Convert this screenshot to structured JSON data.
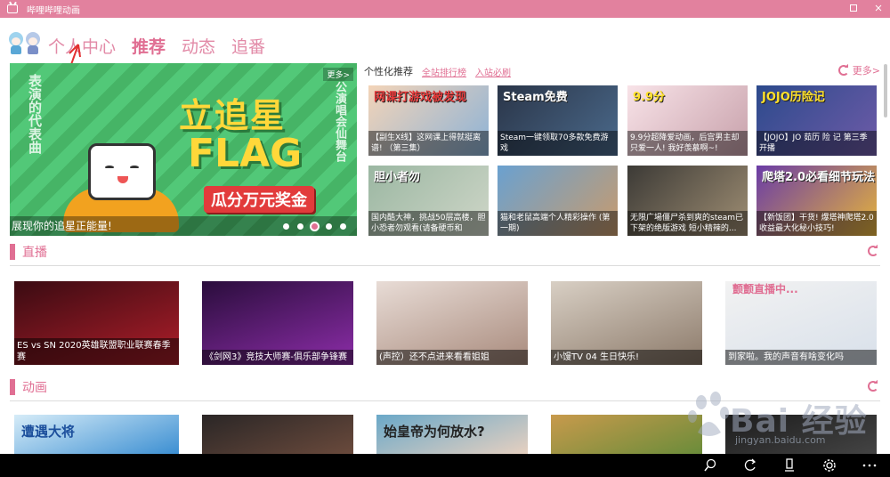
{
  "window": {
    "title": "哔哩哔哩动画"
  },
  "nav": {
    "tabs": [
      {
        "label": "个人中心",
        "active": false
      },
      {
        "label": "推荐",
        "active": true
      },
      {
        "label": "动态",
        "active": false
      },
      {
        "label": "追番",
        "active": false
      }
    ]
  },
  "banner": {
    "more_label": "更多>",
    "left_text": "表演的代表曲",
    "right_text": "公演唱会仙舞台",
    "headline_1": "立追星",
    "headline_2": "FLAG",
    "prize_text": "瓜分万元奖金",
    "caption": "展现你的追星正能量!",
    "dot_count": 5,
    "active_dot": 3
  },
  "personalized": {
    "title": "个性化推荐",
    "links": [
      "全站排行榜",
      "入站必刷"
    ],
    "more_label": "更多>",
    "items": [
      {
        "caption": "【副生X线】这网课上得就挺离谱! （第三集）",
        "overlay": "网课打游戏被发现",
        "overlay_color": "#e53a3a",
        "colors": [
          "#f3d4b8",
          "#8cb2d6"
        ]
      },
      {
        "caption": "Steam一键领取70多款免费游戏",
        "overlay": "Steam免费",
        "overlay_color": "#ffffff",
        "colors": [
          "#2a3548",
          "#4b6a8c"
        ]
      },
      {
        "caption": "9.9分超降爱动画，后宫男主却只爱一人! 我好羡慕啊~!",
        "overlay": "9.9分",
        "overlay_color": "#ffe12c",
        "colors": [
          "#f8e3e8",
          "#c7a0aa"
        ]
      },
      {
        "caption": "【JOJO】JO 茹历 险 记 第三季开播",
        "overlay": "JOJO历险记",
        "overlay_color": "#ffe12c",
        "colors": [
          "#2c4a8c",
          "#6f5ba8"
        ]
      },
      {
        "caption": "国内酷大神，挑战50层高楼，胆小恐者勿观看(请备硬币和",
        "overlay": "胆小者勿",
        "overlay_color": "#ffffff",
        "colors": [
          "#9bb7a2",
          "#cfd6c8"
        ]
      },
      {
        "caption": "猫和老鼠高端个人精彩操作 (第一期)",
        "overlay": "",
        "overlay_color": "#ffffff",
        "colors": [
          "#6aa1d0",
          "#c99b6c"
        ]
      },
      {
        "caption": "无限广場僵尸杀到爽的steam已下架的绝版游戏 短小精辣的...",
        "overlay": "",
        "overlay_color": "#ffffff",
        "colors": [
          "#3c3a36",
          "#a08f74"
        ]
      },
      {
        "caption": "【新饭团】干货! 爆塔神爬塔2.0收益最大化秘小技巧!",
        "overlay": "爬塔2.0必看细节玩法",
        "overlay_color": "#ffffff",
        "colors": [
          "#6a3ca6",
          "#e6b43c"
        ]
      }
    ]
  },
  "live": {
    "label": "直播",
    "items": [
      {
        "caption": "ES vs SN 2020英雄联盟职业联赛春季赛",
        "colors": [
          "#3a0b12",
          "#b01e2a"
        ]
      },
      {
        "caption": "《剑网3》竞技大师赛-俱乐部争锋赛",
        "colors": [
          "#2a0d3c",
          "#8c2da8"
        ]
      },
      {
        "caption": "(声控）还不点进来看看姐姐",
        "colors": [
          "#e8dcd6",
          "#a88a7c"
        ]
      },
      {
        "caption": "小馒TV 04 生日快乐!",
        "colors": [
          "#d8cfc4",
          "#8c7a6a"
        ]
      },
      {
        "caption": "到家啦。我的声音有啥变化吗",
        "colors": [
          "#f2f2f2",
          "#d8e0ea"
        ]
      }
    ],
    "top_label_5": "颤颤直播中..."
  },
  "anime": {
    "label": "动画",
    "items": [
      {
        "overlay": "遭遇大将",
        "colors": [
          "#d6ecf8",
          "#3c8fd2"
        ]
      },
      {
        "overlay": "",
        "colors": [
          "#2a2626",
          "#6a4a3c"
        ]
      },
      {
        "overlay": "始皇帝为何放水?",
        "colors": [
          "#6aa8c8",
          "#e6d0c0"
        ]
      },
      {
        "overlay": "",
        "colors": [
          "#c89a4c",
          "#6a8c3a"
        ]
      },
      {
        "overlay": "",
        "colors": [
          "#1c1c1c",
          "#444444"
        ]
      }
    ]
  },
  "watermark": {
    "text": "Bai 经验",
    "url": "jingyan.baidu.com"
  },
  "colors": {
    "accent": "#e06f93",
    "titlebar": "#e2819e"
  }
}
